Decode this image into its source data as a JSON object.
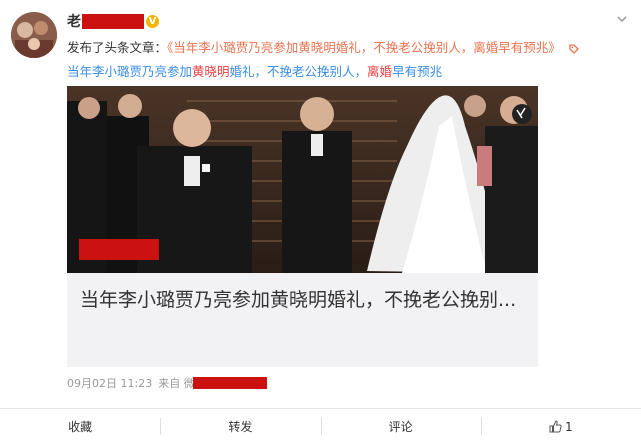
{
  "user": {
    "name_visible": "老"
  },
  "post": {
    "prefix": "发布了头条文章：",
    "link_text": "《当年李小璐贾乃亮参加黄晓明婚礼，不挽老公挽别人，离婚早有预兆》",
    "sub_before": "当年李小璐贾乃亮参加",
    "sub_hl1": "黄晓明",
    "sub_middle": "婚礼，不挽老公挽别人，",
    "sub_hl2": "离婚",
    "sub_after": "早有预兆"
  },
  "card": {
    "title": "当年李小璐贾乃亮参加黄晓明婚礼，不挽老公挽别..."
  },
  "meta": {
    "time": "09月02日 11:23",
    "from": "来自 微"
  },
  "actions": {
    "collect": "收藏",
    "repost": "转发",
    "comment": "评论",
    "like_count": "1"
  },
  "colors": {
    "link": "#eb7350",
    "blue": "#3a8ee6",
    "red_highlight": "#e83c3c",
    "redaction": "#cc1111"
  }
}
